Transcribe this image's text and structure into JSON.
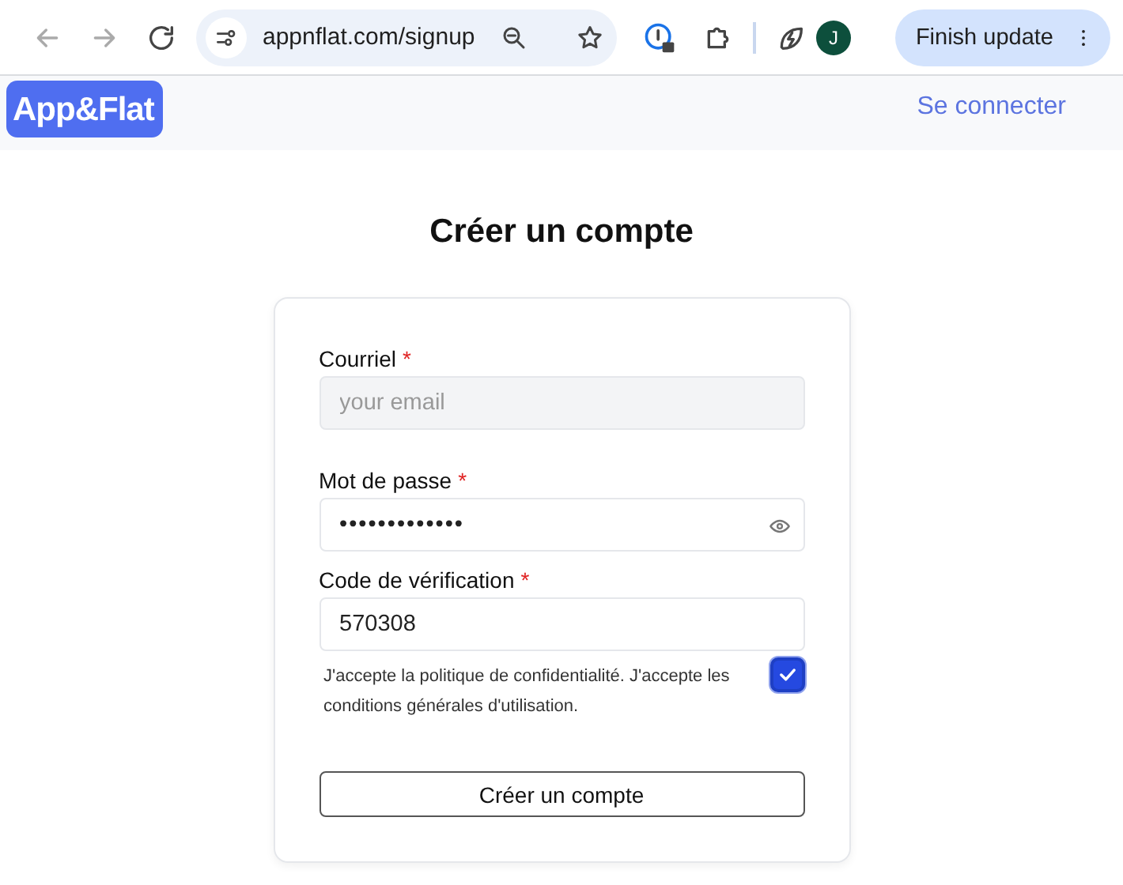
{
  "browser": {
    "url": "appnflat.com/signup",
    "avatar_letter": "J",
    "update_button": "Finish update"
  },
  "header": {
    "logo": "App&Flat",
    "login_link": "Se connecter"
  },
  "page_title": "Créer un compte",
  "fields": [
    {
      "label": "Courriel",
      "required_mark": "*",
      "placeholder": "your email",
      "kind": "email"
    },
    {
      "label": "Mot de passe",
      "required_mark": "*",
      "value": "•••••••••••••",
      "kind": "password"
    },
    {
      "label": "Code de vérification",
      "required_mark": "*",
      "value": "570308",
      "kind": "text"
    }
  ],
  "terms": {
    "text": "J'accepte la politique de confidentialité. J'accepte les conditions générales d'utilisation.",
    "checked": true
  },
  "submit_button": "Créer un compte"
}
